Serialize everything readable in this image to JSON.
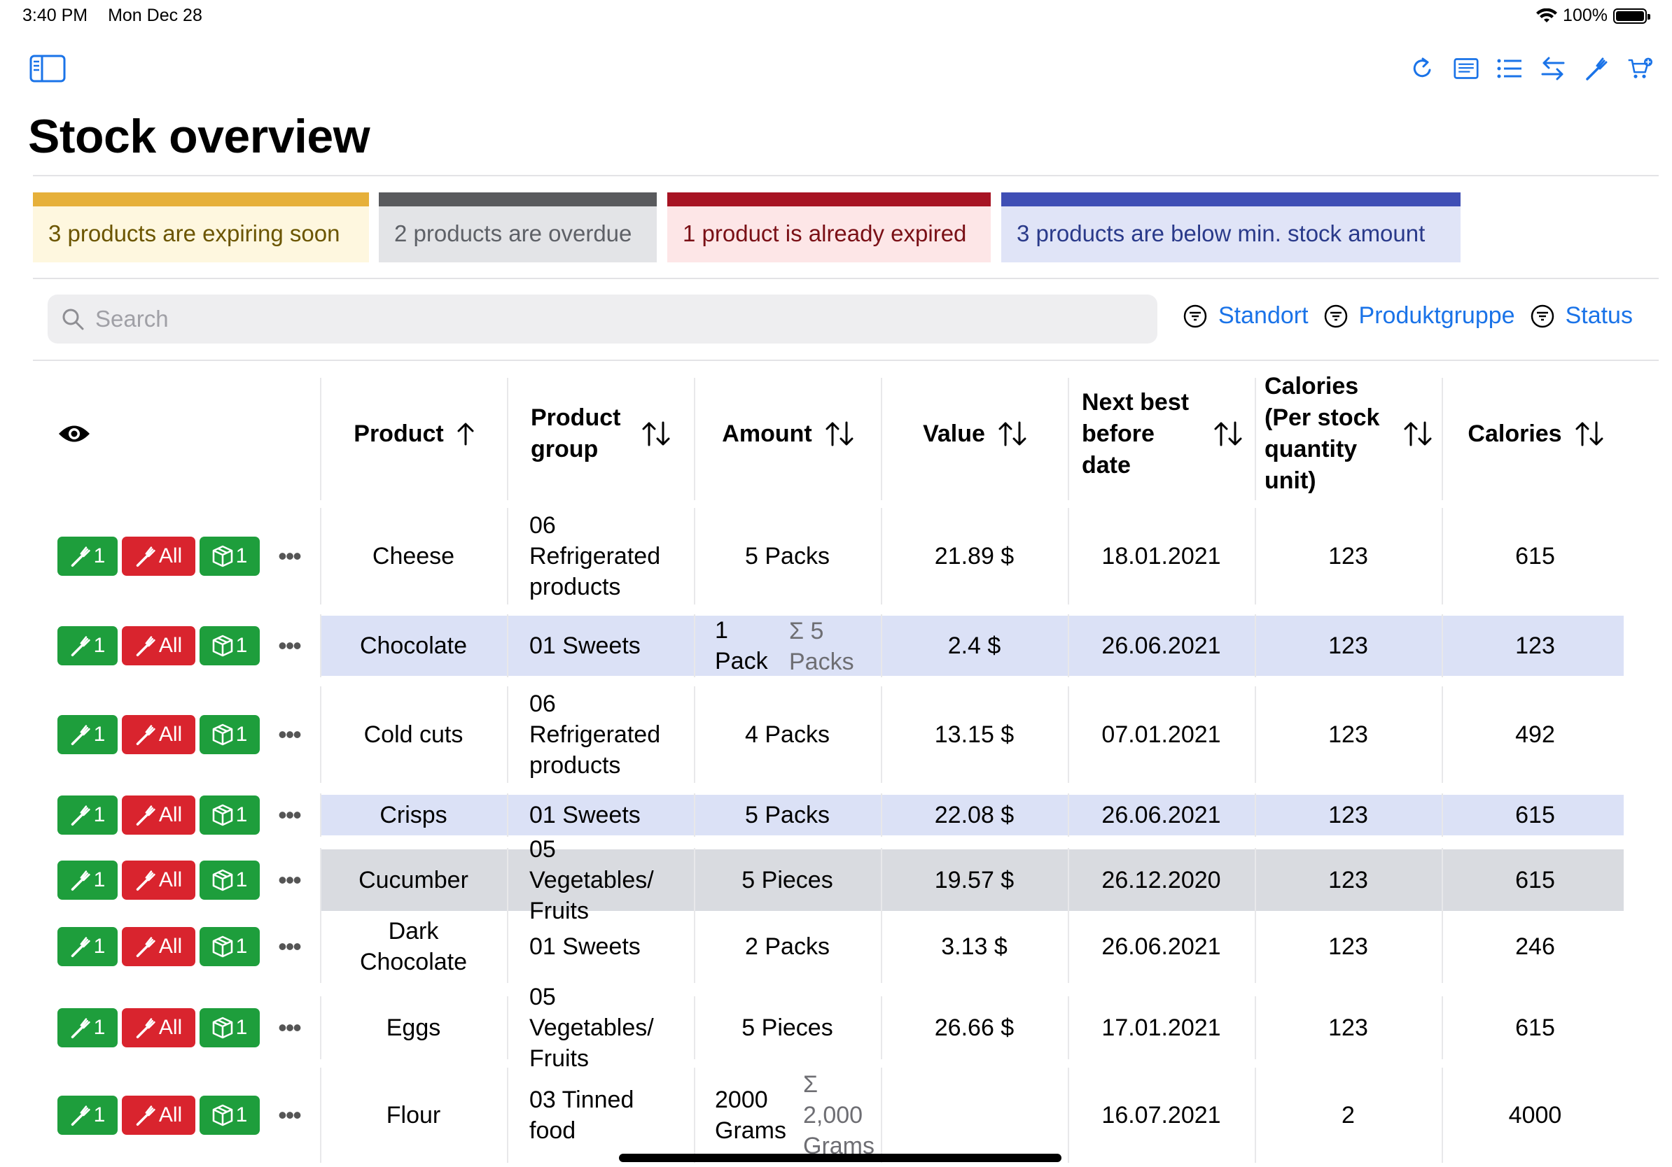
{
  "status_bar": {
    "time": "3:40 PM",
    "date": "Mon Dec 28",
    "battery": "100%"
  },
  "page": {
    "title": "Stock overview"
  },
  "toolbar": {
    "icons": [
      "refresh-icon",
      "journal-icon",
      "list-icon",
      "transfer-icon",
      "consume-icon",
      "shopping-cart-add-icon"
    ]
  },
  "alerts": [
    {
      "text": "3 products are expiring soon",
      "color": "#e6b03a"
    },
    {
      "text": "2 products are overdue",
      "color": "#595a5d"
    },
    {
      "text": "1 product is already expired",
      "color": "#a71323"
    },
    {
      "text": "3 products are below min. stock amount",
      "color": "#3f4eb5"
    }
  ],
  "search": {
    "placeholder": "Search"
  },
  "filters": [
    "Standort",
    "Produktgruppe",
    "Status"
  ],
  "table": {
    "headers": {
      "product": "Product",
      "product_group": "Product group",
      "amount": "Amount",
      "value": "Value",
      "next_best_before": "Next best before date",
      "calories_per_unit": "Calories (Per stock quantity unit)",
      "calories": "Calories"
    },
    "action_labels": {
      "consume_one": "1",
      "consume_all": "All",
      "open_one": "1"
    },
    "rows": [
      {
        "product": "Cheese",
        "group": "06 Refrigerated products",
        "amount": "5 Packs",
        "amount_sum": "",
        "value": "21.89 $",
        "date": "18.01.2021",
        "cal_unit": "123",
        "calories": "615",
        "highlight": "none"
      },
      {
        "product": "Chocolate",
        "group": "01 Sweets",
        "amount": "1 Pack",
        "amount_sum": "Σ 5 Packs",
        "value": "2.4 $",
        "date": "26.06.2021",
        "cal_unit": "123",
        "calories": "123",
        "highlight": "below-min"
      },
      {
        "product": "Cold cuts",
        "group": "06 Refrigerated products",
        "amount": "4 Packs",
        "amount_sum": "",
        "value": "13.15 $",
        "date": "07.01.2021",
        "cal_unit": "123",
        "calories": "492",
        "highlight": "none"
      },
      {
        "product": "Crisps",
        "group": "01 Sweets",
        "amount": "5 Packs",
        "amount_sum": "",
        "value": "22.08 $",
        "date": "26.06.2021",
        "cal_unit": "123",
        "calories": "615",
        "highlight": "below-min"
      },
      {
        "product": "Cucumber",
        "group": "05 Vegetables/ Fruits",
        "amount": "5 Pieces",
        "amount_sum": "",
        "value": "19.57 $",
        "date": "26.12.2020",
        "cal_unit": "123",
        "calories": "615",
        "highlight": "overdue"
      },
      {
        "product": "Dark Chocolate",
        "group": "01 Sweets",
        "amount": "2 Packs",
        "amount_sum": "",
        "value": "3.13 $",
        "date": "26.06.2021",
        "cal_unit": "123",
        "calories": "246",
        "highlight": "none"
      },
      {
        "product": "Eggs",
        "group": "05 Vegetables/ Fruits",
        "amount": "5 Pieces",
        "amount_sum": "",
        "value": "26.66 $",
        "date": "17.01.2021",
        "cal_unit": "123",
        "calories": "615",
        "highlight": "none"
      },
      {
        "product": "Flour",
        "group": "03 Tinned food",
        "amount": "2000 Grams",
        "amount_sum": "Σ 2,000 Grams",
        "value": "",
        "date": "16.07.2021",
        "cal_unit": "2",
        "calories": "4000",
        "highlight": "none"
      }
    ]
  },
  "colors": {
    "accent": "#1a73e8",
    "consume": "#1e9e3c",
    "consume_all": "#d9242e",
    "below_min_row": "#dbe1f6",
    "overdue_row": "#d9dbe0"
  }
}
